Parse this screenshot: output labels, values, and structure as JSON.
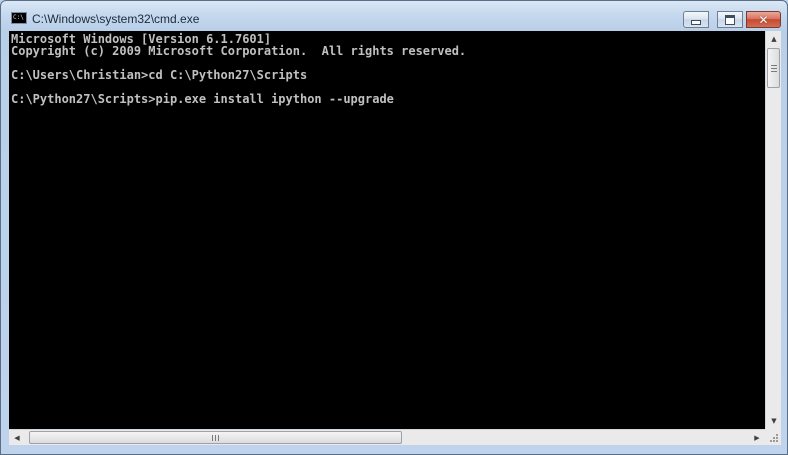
{
  "window": {
    "title": "C:\\Windows\\system32\\cmd.exe",
    "icon": "cmd-console-icon",
    "icon_text": "C:\\",
    "controls": {
      "minimize_icon": "minimize-icon",
      "maximize_icon": "maximize-icon",
      "close_icon": "close-icon",
      "close_glyph": "✕"
    }
  },
  "console": {
    "background": "#000000",
    "foreground": "#c0c0c0",
    "lines": [
      "Microsoft Windows [Version 6.1.7601]",
      "Copyright (c) 2009 Microsoft Corporation.  All rights reserved.",
      "C:\\Users\\Christian>cd C:\\Python27\\Scripts",
      "C:\\Python27\\Scripts>pip.exe install ipython --upgrade"
    ]
  },
  "scrollbars": {
    "up_arrow": "▲",
    "down_arrow": "▼",
    "left_arrow": "◀",
    "right_arrow": "▶"
  },
  "colors": {
    "frame": "#bfd4ec",
    "close_button": "#c44a32"
  }
}
